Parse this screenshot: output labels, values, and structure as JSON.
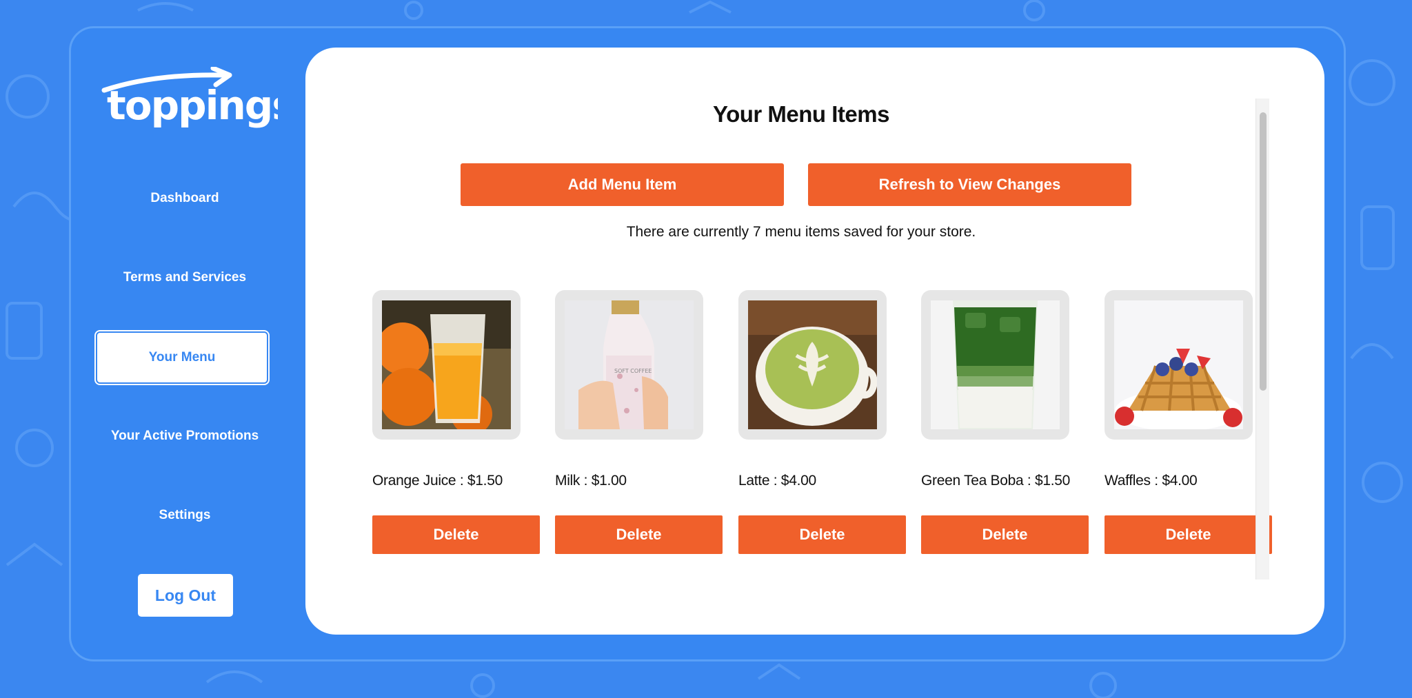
{
  "brand": {
    "name": "toppings"
  },
  "nav": {
    "items": [
      {
        "label": "Dashboard"
      },
      {
        "label": "Terms and Services"
      },
      {
        "label": "Your Menu"
      },
      {
        "label": "Your Active Promotions"
      },
      {
        "label": "Settings"
      }
    ],
    "logout_label": "Log Out"
  },
  "main": {
    "title": "Your Menu Items",
    "add_button": "Add Menu Item",
    "refresh_button": "Refresh to View Changes",
    "summary": "There are currently 7 menu items saved for your store.",
    "delete_label": "Delete",
    "items": [
      {
        "label": "Orange Juice : $1.50",
        "image": "orange-juice"
      },
      {
        "label": "Milk : $1.00",
        "image": "milk-bottle"
      },
      {
        "label": "Latte : $4.00",
        "image": "matcha-latte"
      },
      {
        "label": "Green Tea Boba : $1.50",
        "image": "green-tea-boba"
      },
      {
        "label": "Waffles : $4.00",
        "image": "waffles"
      }
    ]
  },
  "colors": {
    "background": "#3b87f0",
    "accent": "#f0602b",
    "panel": "#ffffff"
  }
}
